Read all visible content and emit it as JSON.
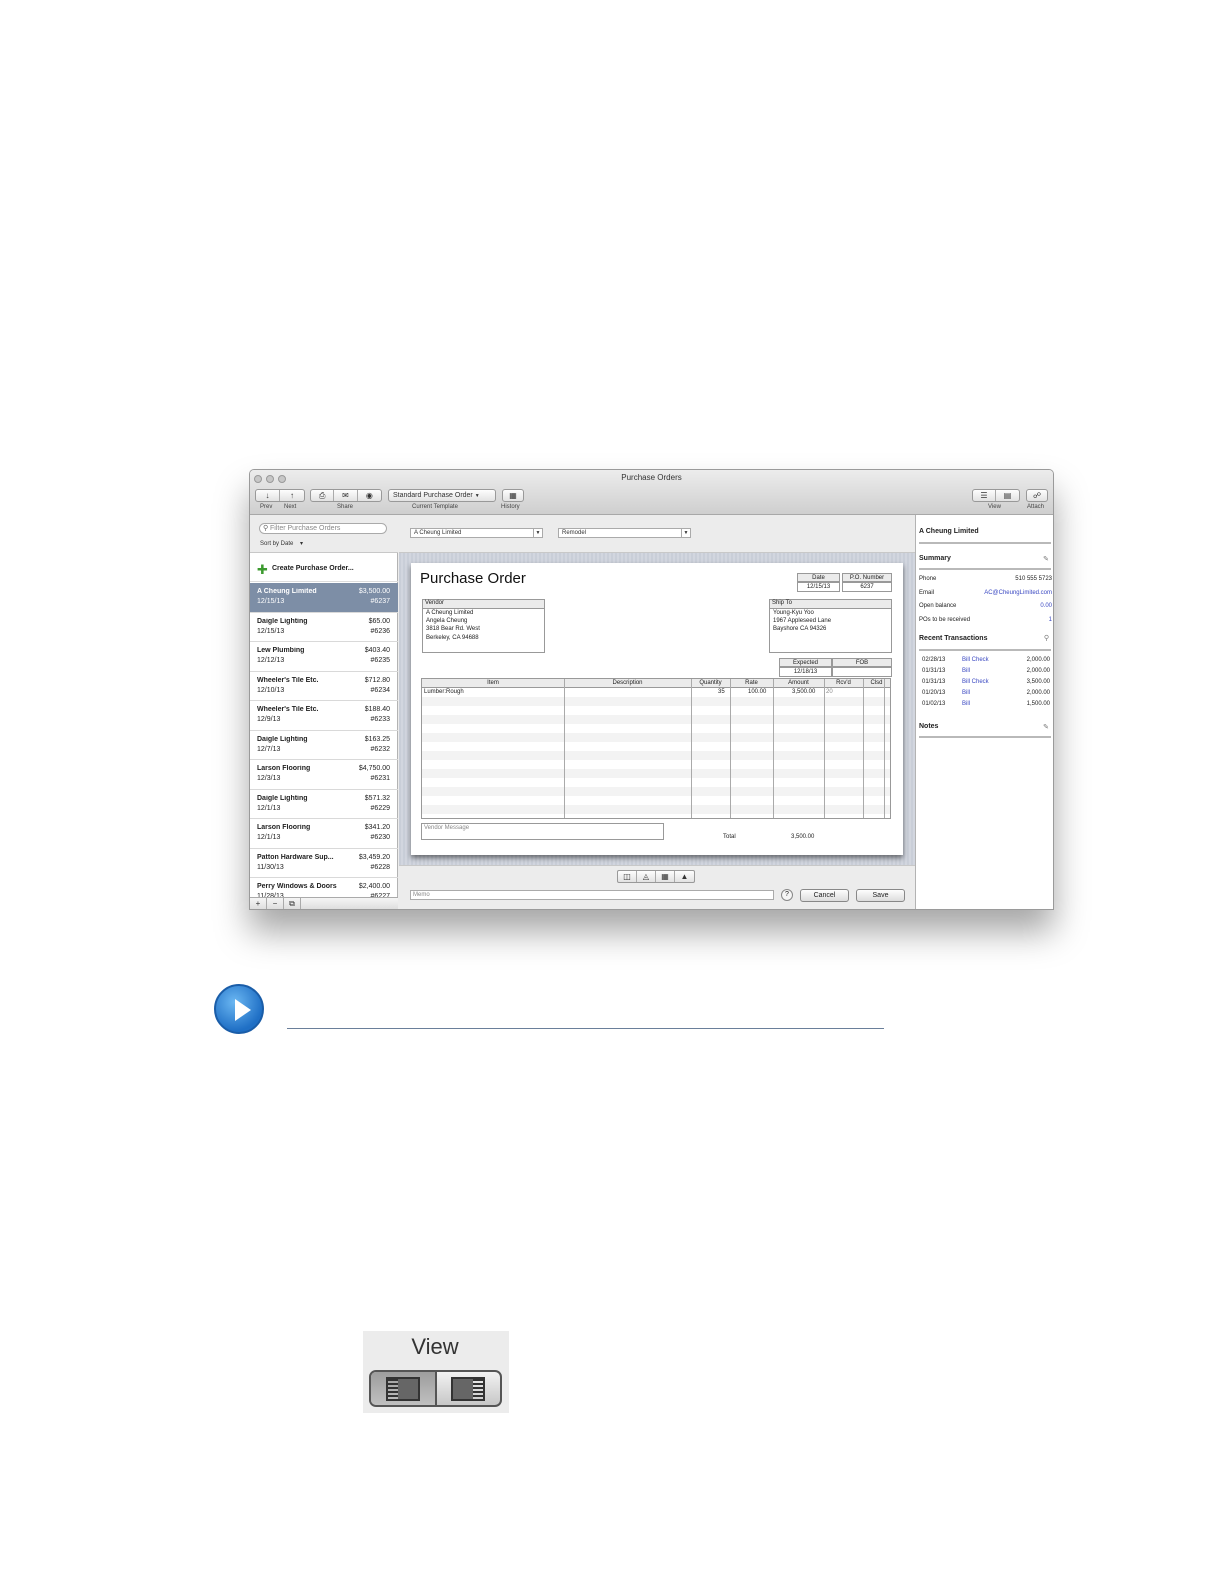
{
  "window": {
    "title": "Purchase Orders"
  },
  "toolbar": {
    "prev_label": "Prev",
    "next_label": "Next",
    "share_label": "Share",
    "template_value": "Standard Purchase Order",
    "template_label": "Current Template",
    "history_label": "History",
    "view_label": "View",
    "attach_label": "Attach"
  },
  "left": {
    "filter_placeholder": "Filter Purchase Orders",
    "sort_label": "Sort by Date",
    "create_label": "Create Purchase Order...",
    "items": [
      {
        "name": "A Cheung Limited",
        "amount": "$3,500.00",
        "date": "12/15/13",
        "number": "#6237"
      },
      {
        "name": "Daigle Lighting",
        "amount": "$65.00",
        "date": "12/15/13",
        "number": "#6236"
      },
      {
        "name": "Lew Plumbing",
        "amount": "$403.40",
        "date": "12/12/13",
        "number": "#6235"
      },
      {
        "name": "Wheeler's Tile Etc.",
        "amount": "$712.80",
        "date": "12/10/13",
        "number": "#6234"
      },
      {
        "name": "Wheeler's Tile Etc.",
        "amount": "$188.40",
        "date": "12/9/13",
        "number": "#6233"
      },
      {
        "name": "Daigle Lighting",
        "amount": "$163.25",
        "date": "12/7/13",
        "number": "#6232"
      },
      {
        "name": "Larson Flooring",
        "amount": "$4,750.00",
        "date": "12/3/13",
        "number": "#6231"
      },
      {
        "name": "Daigle Lighting",
        "amount": "$571.32",
        "date": "12/1/13",
        "number": "#6229"
      },
      {
        "name": "Larson Flooring",
        "amount": "$341.20",
        "date": "12/1/13",
        "number": "#6230"
      },
      {
        "name": "Patton Hardware Sup...",
        "amount": "$3,459.20",
        "date": "11/30/13",
        "number": "#6228"
      },
      {
        "name": "Perry Windows & Doors",
        "amount": "$2,400.00",
        "date": "11/28/13",
        "number": "#6227"
      }
    ]
  },
  "form": {
    "vendor_select": "A Cheung Limited",
    "class_select": "Remodel",
    "title": "Purchase Order",
    "date_label": "Date",
    "date_value": "12/15/13",
    "po_label": "P.O. Number",
    "po_value": "6237",
    "vendor_caption": "Vendor",
    "vendor_lines": [
      "A Cheung Limited",
      "Angela Cheung",
      "3818 Bear Rd. West",
      "Berkeley, CA 94688"
    ],
    "shipto_caption": "Ship To",
    "shipto_lines": [
      "Young-Kyu Yoo",
      "1967 Appleseed Lane",
      "Bayshore CA 94326"
    ],
    "expected_label": "Expected",
    "expected_value": "12/18/13",
    "fob_label": "FOB",
    "columns": [
      "Item",
      "Description",
      "Quantity",
      "Rate",
      "Amount",
      "Rcv'd",
      "Clsd"
    ],
    "line": {
      "item": "Lumber:Rough",
      "quantity": "35",
      "rate": "100.00",
      "amount": "3,500.00",
      "rcvd": "20"
    },
    "vendor_message_placeholder": "Vendor Message",
    "total_label": "Total",
    "total_value": "3,500.00",
    "memo_placeholder": "Memo",
    "help_label": "?",
    "cancel_label": "Cancel",
    "save_label": "Save"
  },
  "right": {
    "title": "A Cheung Limited",
    "summary_label": "Summary",
    "phone_label": "Phone",
    "phone_value": "510 555 5723",
    "email_label": "Email",
    "email_value": "AC@CheungLimited.com",
    "balance_label": "Open balance",
    "balance_value": "0.00",
    "pos_label": "POs to be received",
    "pos_value": "1",
    "recent_label": "Recent Transactions",
    "transactions": [
      {
        "date": "02/28/13",
        "type": "Bill Check",
        "amount": "2,000.00"
      },
      {
        "date": "01/31/13",
        "type": "Bill",
        "amount": "2,000.00"
      },
      {
        "date": "01/31/13",
        "type": "Bill Check",
        "amount": "3,500.00"
      },
      {
        "date": "01/20/13",
        "type": "Bill",
        "amount": "2,000.00"
      },
      {
        "date": "01/02/13",
        "type": "Bill",
        "amount": "1,500.00"
      }
    ],
    "notes_label": "Notes"
  },
  "callout": {
    "view_label": "View"
  },
  "colors": {
    "selection": "#7d8ea6",
    "link": "#3a48c2",
    "play": "#1f6fc5"
  }
}
